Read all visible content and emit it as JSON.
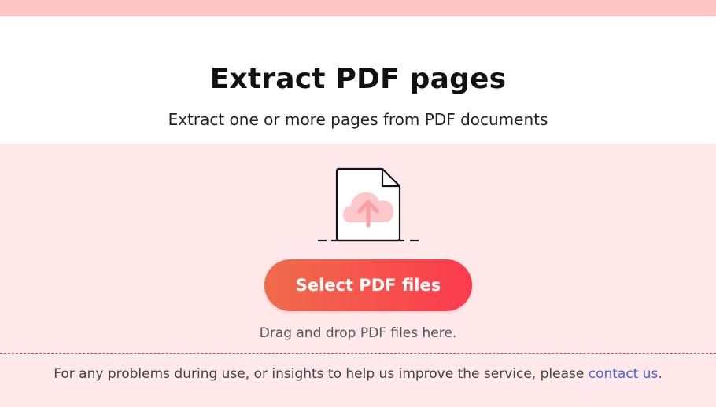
{
  "header": {
    "title": "Extract PDF pages",
    "subtitle": "Extract one or more pages from PDF documents"
  },
  "upload": {
    "icon": "file-cloud-upload-icon",
    "select_button_label": "Select PDF files",
    "drop_hint": "Drag and drop PDF files here."
  },
  "footer": {
    "text_before_link": "For any problems during use, or insights to help us improve the service, please ",
    "link_text": "contact us",
    "text_after_link": "."
  },
  "colors": {
    "top_bar": "#fdc5c6",
    "upload_background": "#ffe8e9",
    "button_gradient_start": "#ef6c4b",
    "button_gradient_end": "#fc3a4f",
    "link": "#4a63d8",
    "icon_cloud": "#fdc8ca",
    "icon_arrow": "#f9a0a3"
  }
}
